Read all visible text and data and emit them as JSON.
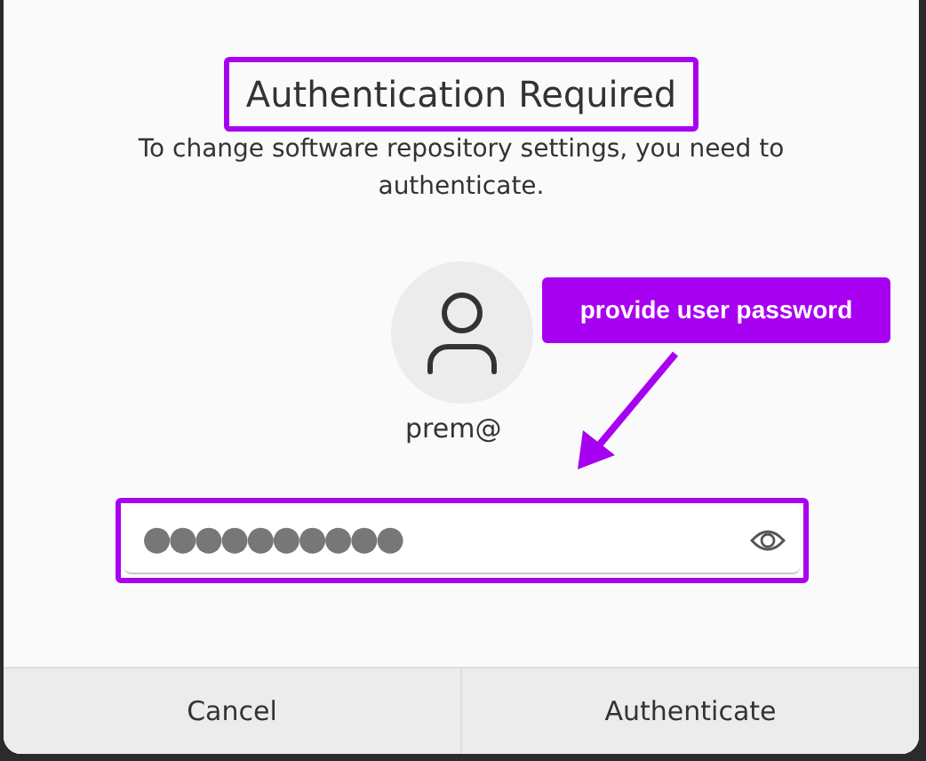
{
  "dialog": {
    "title": "Authentication Required",
    "title_highlighted": true,
    "message": "To change software repository settings, you need to authenticate.",
    "user": {
      "name": "prem@"
    },
    "password": {
      "masked_value": "●●●●●●●●●●",
      "highlighted": true
    },
    "buttons": [
      {
        "label": "Cancel"
      },
      {
        "label": "Authenticate"
      }
    ]
  },
  "annotations": [
    {
      "kind": "callout",
      "text": "provide user password"
    }
  ]
}
